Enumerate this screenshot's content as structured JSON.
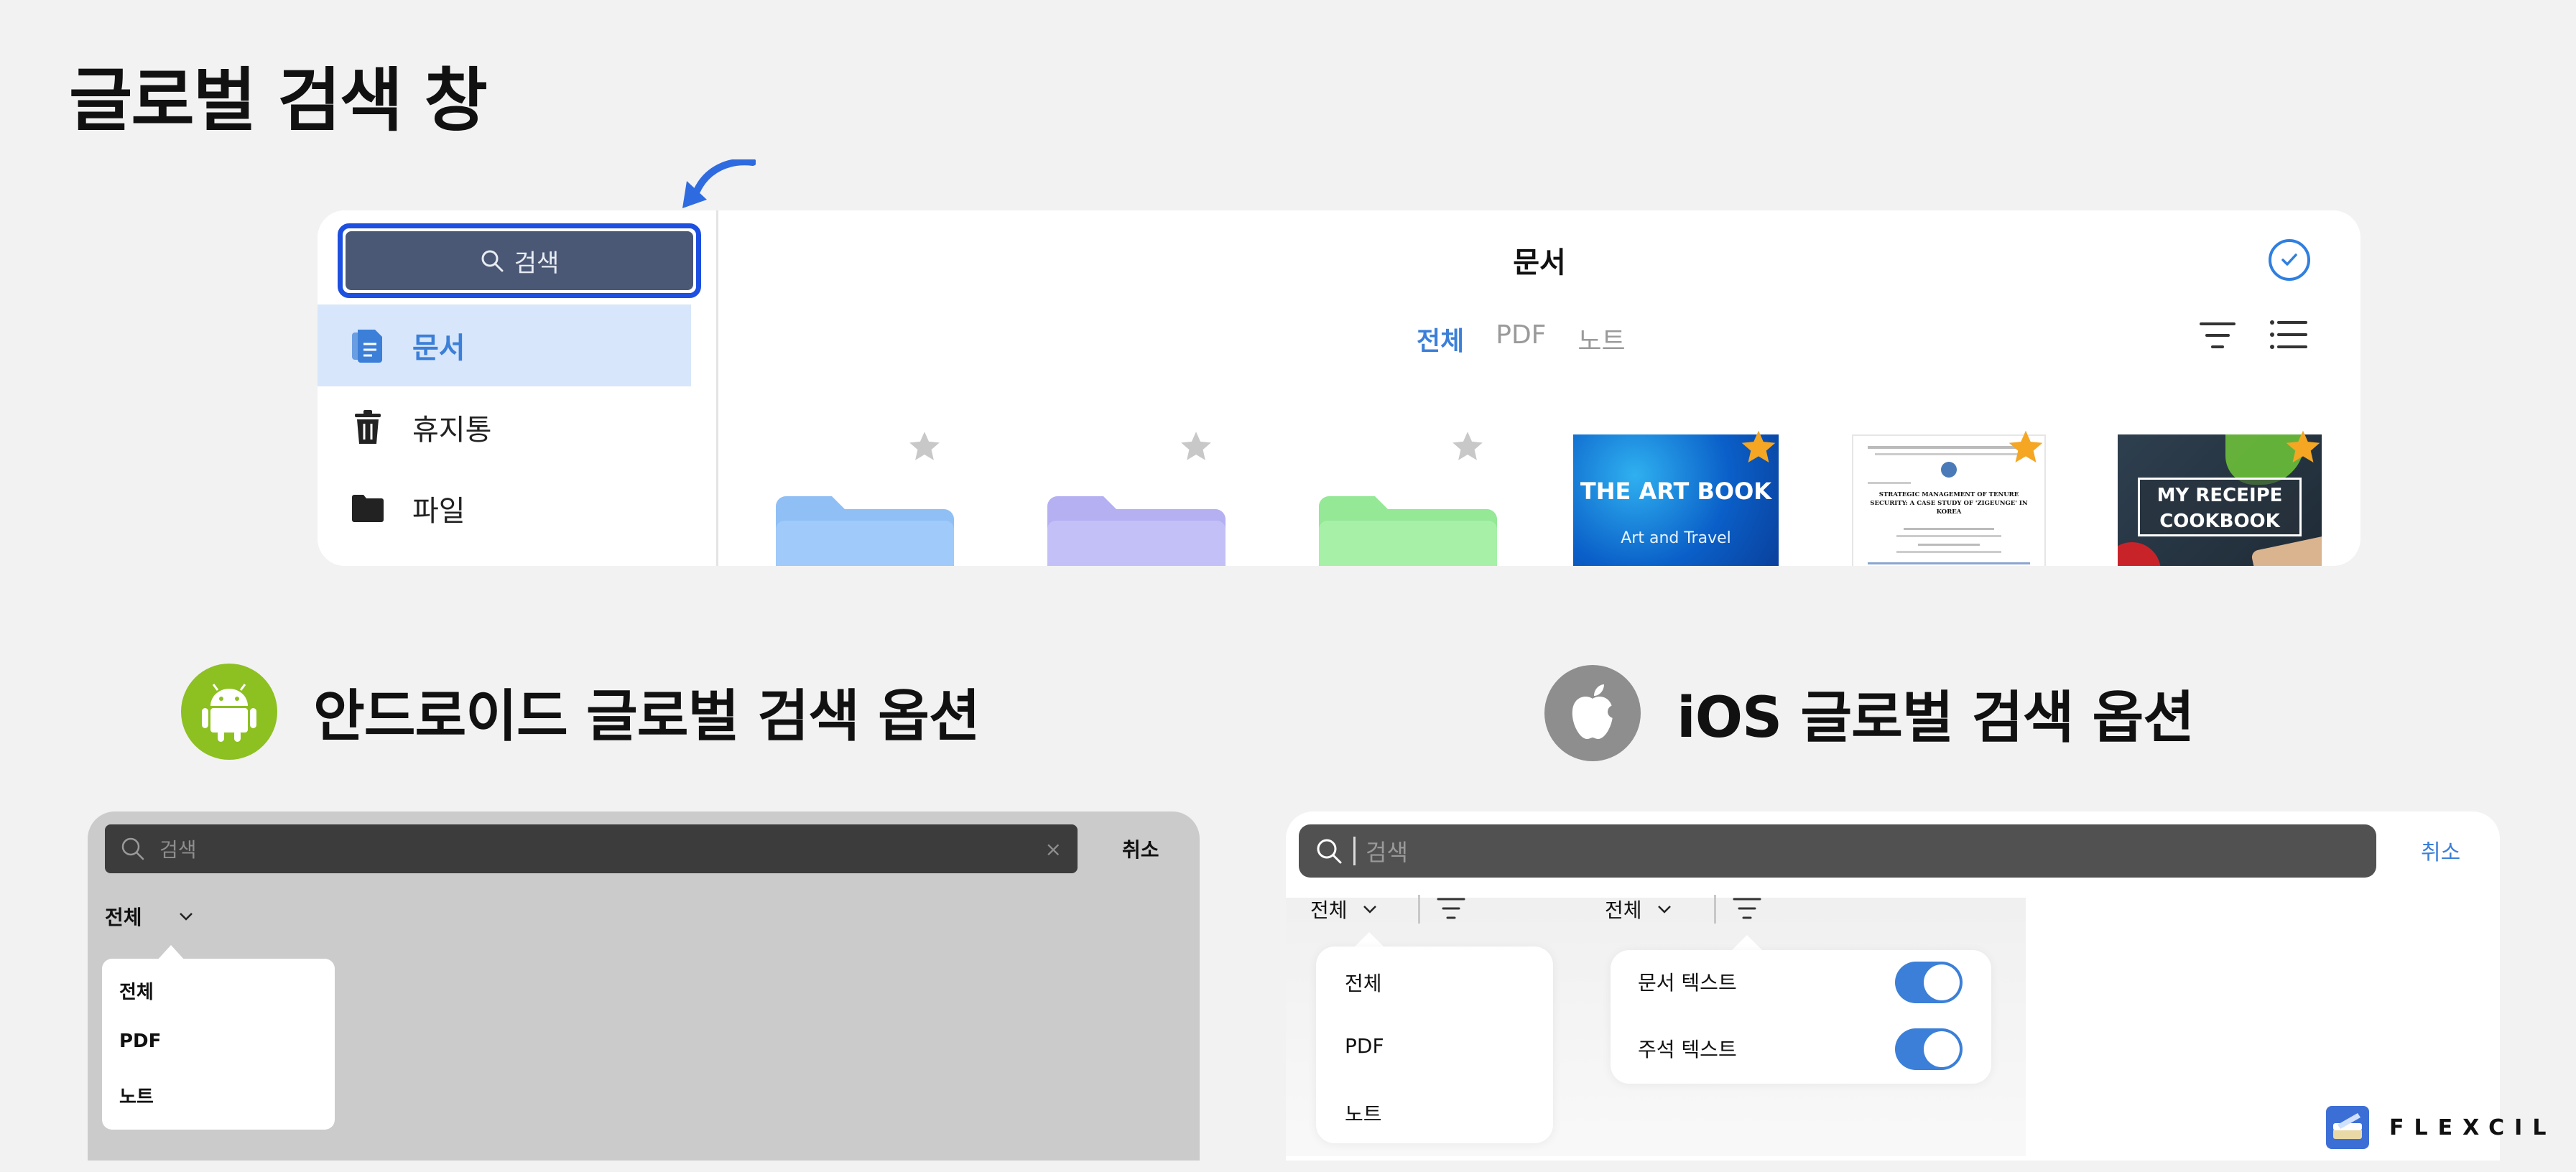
{
  "page": {
    "title": "글로벌 검색 창"
  },
  "top_panel": {
    "search_button_label": "검색",
    "nav": [
      {
        "label": "문서",
        "icon": "document-icon",
        "active": true
      },
      {
        "label": "휴지통",
        "icon": "trash-icon",
        "active": false
      },
      {
        "label": "파일",
        "icon": "folder-icon",
        "active": false
      }
    ],
    "header_title": "문서",
    "tabs": [
      {
        "label": "전체",
        "active": true
      },
      {
        "label": "PDF",
        "active": false
      },
      {
        "label": "노트",
        "active": false
      }
    ],
    "items": [
      {
        "kind": "folder",
        "color": "#9fcaf9",
        "starred": false
      },
      {
        "kind": "folder",
        "color": "#c3c0f7",
        "starred": false
      },
      {
        "kind": "folder",
        "color": "#a6f0a8",
        "starred": false
      },
      {
        "kind": "cover",
        "title": "THE ART BOOK",
        "subtitle": "Art and Travel",
        "starred": true
      },
      {
        "kind": "paper",
        "title": "STRATEGIC MANAGEMENT OF TENURE SECURITY: A CASE STUDY OF 'ZIGEUNGE' IN KOREA",
        "starred": true
      },
      {
        "kind": "cover",
        "title": "MY RECEIPE COOKBOOK",
        "starred": true
      }
    ]
  },
  "android": {
    "heading": "안드로이드 글로벌 검색 옵션",
    "search_placeholder": "검색",
    "clear": "×",
    "cancel": "취소",
    "filter_value": "전체",
    "menu": [
      "전체",
      "PDF",
      "노트"
    ]
  },
  "ios": {
    "heading": "iOS 글로벌 검색 옵션",
    "search_placeholder": "검색",
    "cancel": "취소",
    "filter_value_1": "전체",
    "filter_value_2": "전체",
    "menu": [
      "전체",
      "PDF",
      "노트"
    ],
    "options": [
      {
        "label": "문서 텍스트",
        "on": true
      },
      {
        "label": "주석 텍스트",
        "on": true
      }
    ]
  },
  "brand": {
    "name": "FLEXCIL"
  },
  "colors": {
    "accent": "#3b7fd8",
    "highlight": "#1d4fe0",
    "star": "#f5a623",
    "android": "#8dc021",
    "apple": "#8e8e8e"
  }
}
